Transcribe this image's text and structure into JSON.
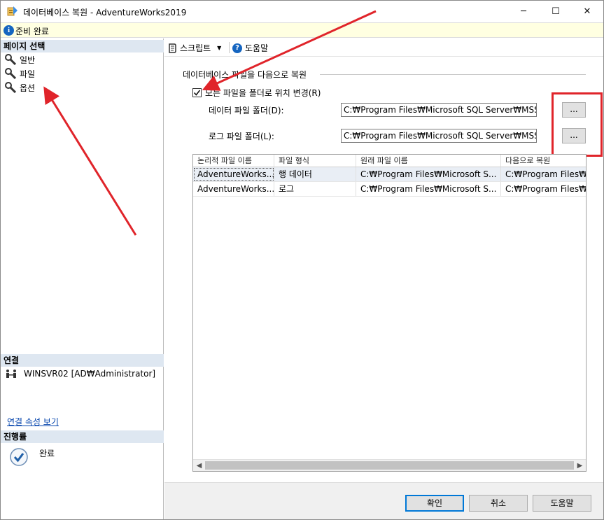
{
  "window": {
    "title": "데이터베이스 복원 - AdventureWorks2019",
    "minimize": "─",
    "maximize": "☐",
    "close": "✕"
  },
  "status": {
    "text": "준비 완료"
  },
  "left": {
    "page_select_header": "페이지 선택",
    "pages": [
      "일반",
      "파일",
      "옵션"
    ],
    "connection_header": "연결",
    "connection_text": "WINSVR02 [AD₩Administrator]",
    "connection_link": "연결 속성 보기",
    "progress_header": "진행률",
    "progress_text": "완료"
  },
  "toolbar": {
    "script_label": "스크립트",
    "help_label": "도움말"
  },
  "restore": {
    "group_label": "데이터베이스 파일을 다음으로 복원",
    "relocate_label": "모든 파일을 폴더로 위치 변경(R)",
    "relocate_checked": true,
    "data_folder_label": "데이터 파일 폴더(D):",
    "data_folder_value": "C:₩Program Files₩Microsoft SQL Server₩MSSQL",
    "log_folder_label": "로그 파일 폴더(L):",
    "log_folder_value": "C:₩Program Files₩Microsoft SQL Server₩MSSQL",
    "browse_label": "..."
  },
  "grid": {
    "columns": [
      "논리적 파일 이름",
      "파일 형식",
      "원래 파일 이름",
      "다음으로 복원"
    ],
    "rows": [
      [
        "AdventureWorks...",
        "행 데이터",
        "C:₩Program Files₩Microsoft S...",
        "C:₩Program Files₩"
      ],
      [
        "AdventureWorks...",
        "로그",
        "C:₩Program Files₩Microsoft S...",
        "C:₩Program Files₩"
      ]
    ]
  },
  "buttons": {
    "ok": "확인",
    "cancel": "취소",
    "help": "도움말"
  },
  "colors": {
    "accent": "#0078d7",
    "annotation_red": "#e0242a",
    "status_bg": "#ffffe1",
    "section_bg": "#dee7f1"
  }
}
